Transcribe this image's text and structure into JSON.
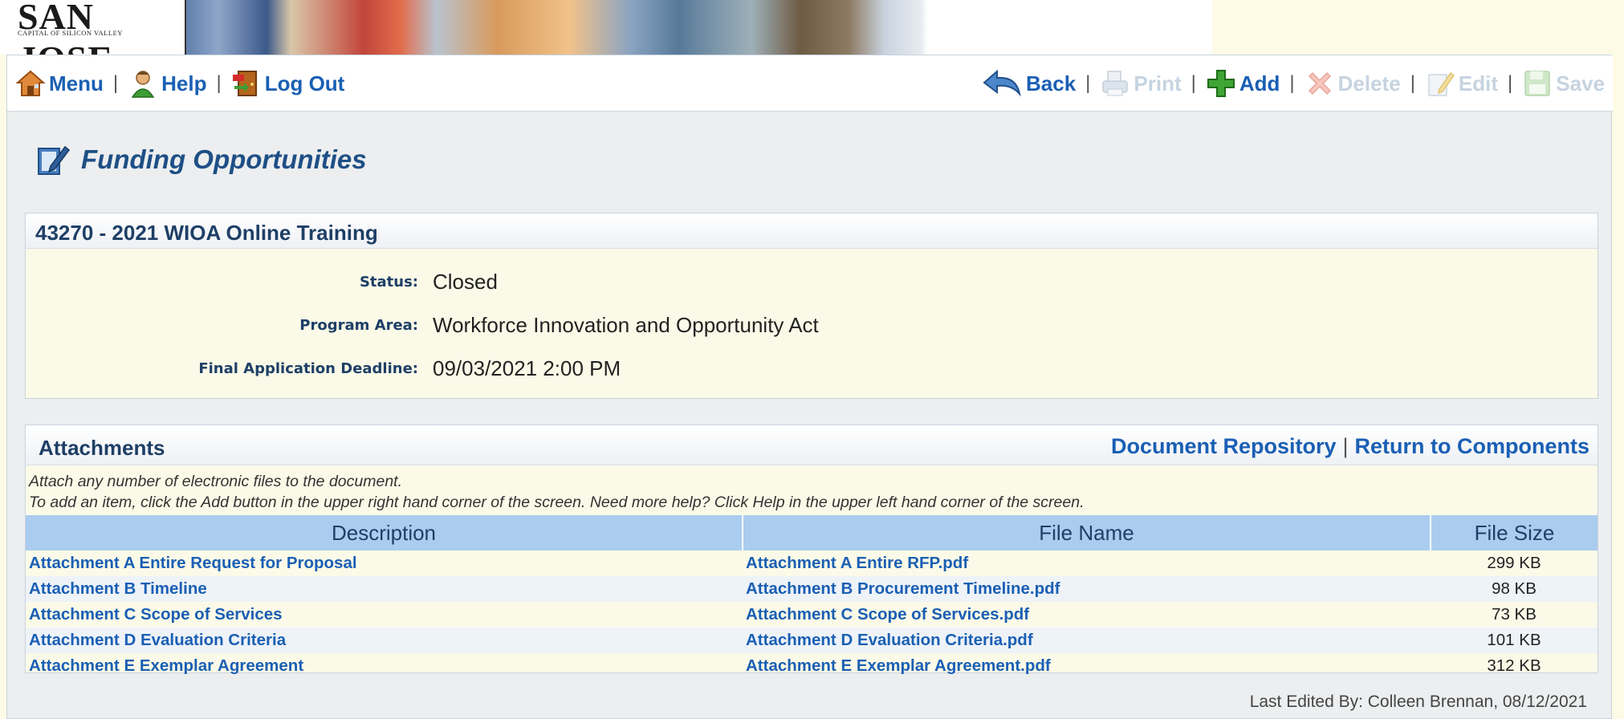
{
  "banner": {
    "logo_title": "SAN JOSE",
    "logo_subtitle": "CAPITAL OF SILICON VALLEY"
  },
  "toolbar": {
    "left": [
      {
        "label": "Menu",
        "icon": "house-icon"
      },
      {
        "label": "Help",
        "icon": "person-help-icon"
      },
      {
        "label": "Log Out",
        "icon": "exit-door-icon"
      }
    ],
    "right": [
      {
        "label": "Back",
        "icon": "back-arrow-icon",
        "enabled": true
      },
      {
        "label": "Print",
        "icon": "printer-icon",
        "enabled": false
      },
      {
        "label": "Add",
        "icon": "green-plus-icon",
        "enabled": true
      },
      {
        "label": "Delete",
        "icon": "red-x-icon",
        "enabled": false
      },
      {
        "label": "Edit",
        "icon": "pencil-notepad-icon",
        "enabled": false
      },
      {
        "label": "Save",
        "icon": "floppy-disk-icon",
        "enabled": false
      }
    ]
  },
  "page": {
    "title": "Funding Opportunities"
  },
  "opportunity": {
    "heading": "43270 - 2021 WIOA Online Training",
    "fields": [
      {
        "label": "Status:",
        "value": "Closed"
      },
      {
        "label": "Program Area:",
        "value": "Workforce Innovation and Opportunity Act"
      },
      {
        "label": "Final Application Deadline:",
        "value": "09/03/2021 2:00 PM"
      }
    ]
  },
  "attachments": {
    "title": "Attachments",
    "link_repository": "Document Repository",
    "link_separator": "|",
    "link_return": "Return to Components",
    "help_line1": "Attach any number of electronic files to the document.",
    "help_line2": "To add an item, click the Add button in the upper right hand corner of the screen. Need more help? Click Help in the upper left hand corner of the screen.",
    "columns": [
      "Description",
      "File Name",
      "File Size"
    ],
    "rows": [
      {
        "description": "Attachment A Entire Request for Proposal",
        "file_name": "Attachment A Entire RFP.pdf",
        "size": "299 KB"
      },
      {
        "description": "Attachment B Timeline",
        "file_name": "Attachment B Procurement Timeline.pdf",
        "size": "98 KB"
      },
      {
        "description": "Attachment C Scope of Services",
        "file_name": "Attachment C Scope of Services.pdf",
        "size": "73 KB"
      },
      {
        "description": "Attachment D Evaluation Criteria",
        "file_name": "Attachment D Evaluation Criteria.pdf",
        "size": "101 KB"
      },
      {
        "description": "Attachment E Exemplar Agreement",
        "file_name": "Attachment E Exemplar Agreement.pdf",
        "size": "312 KB"
      }
    ]
  },
  "footer": {
    "last_edited": "Last Edited By: Colleen Brennan, 08/12/2021"
  },
  "colors": {
    "link_blue": "#1a5fb4",
    "header_navy": "#1e3f66",
    "table_header_bg": "#aaccef",
    "page_bg": "#fdfbe6"
  }
}
